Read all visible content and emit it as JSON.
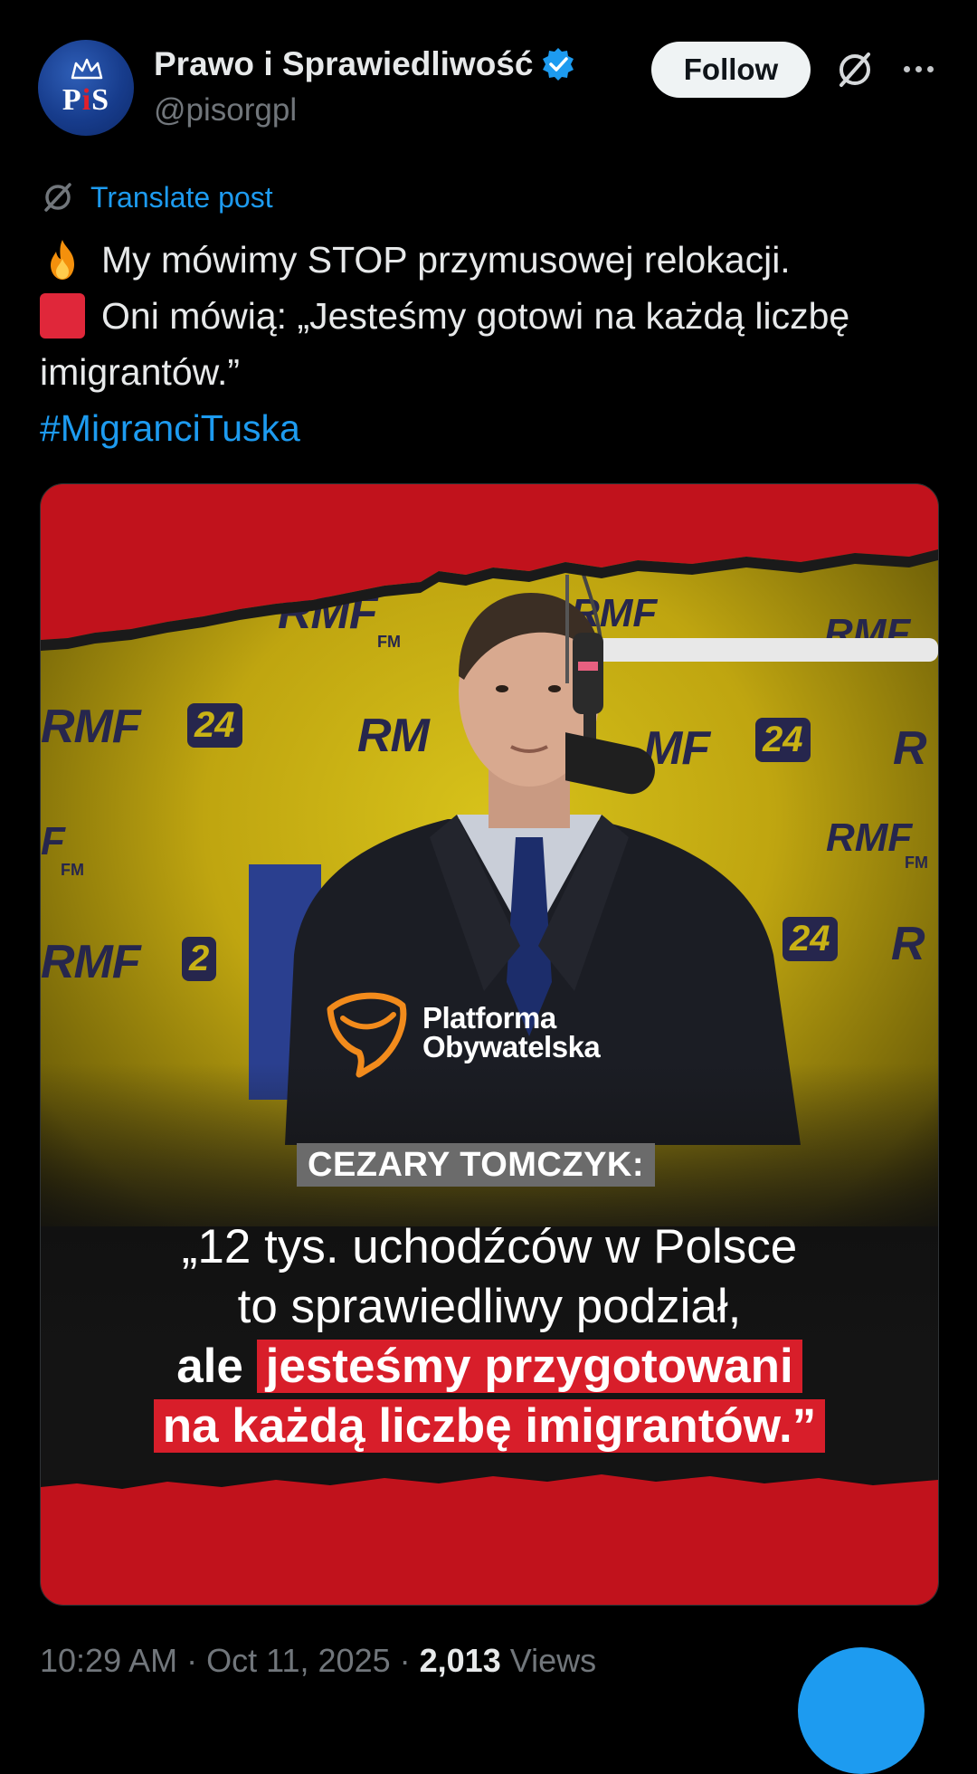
{
  "account": {
    "display_name": "Prawo i Sprawiedliwość",
    "handle": "@pisorgpl",
    "avatar_text": "PiS",
    "verified": true
  },
  "actions": {
    "follow_label": "Follow",
    "grok_icon": "grok-icon",
    "more_icon": "more-icon"
  },
  "translate": {
    "label": "Translate post"
  },
  "tweet": {
    "line1_emoji": "fire-emoji",
    "line1_text": "My mówimy STOP przymusowej relokacji.",
    "line2_emoji": "red-square-emoji",
    "line2_text": "Oni mówią: „Jesteśmy gotowi na każdą liczbę",
    "line3_text": "imigrantów.”",
    "hashtag": "#MigranciTuska"
  },
  "media": {
    "party_name_line1": "Platforma",
    "party_name_line2": "Obywatelska",
    "speaker": "CEZARY TOMCZYK:",
    "quote_line1": "„12 tys. uchodźców w Polsce",
    "quote_line2": "to sprawiedliwy podział,",
    "quote_line3_plain": "ale",
    "quote_line3_highlight": "jesteśmy przygotowani",
    "quote_line4_highlight": "na każdą liczbę imigrantów.”",
    "wall_logo_rmf": "RMF",
    "wall_logo_fm": "FM",
    "wall_logo_24": "24",
    "wall_logo_rm": "RM",
    "wall_logo_mf": "MF",
    "wall_logo_r": "R",
    "wall_logo_rmf_dots": "RMF...",
    "wall_logo_f": "F",
    "wall_logo_2": "2"
  },
  "footer": {
    "time": "10:29 AM",
    "separator": "·",
    "date": "Oct 11, 2025",
    "views_count": "2,013",
    "views_label": "Views"
  },
  "colors": {
    "background": "#000000",
    "accent": "#1d9bf0",
    "highlight_red": "#d81e2a",
    "wall_yellow": "#c9b215"
  }
}
